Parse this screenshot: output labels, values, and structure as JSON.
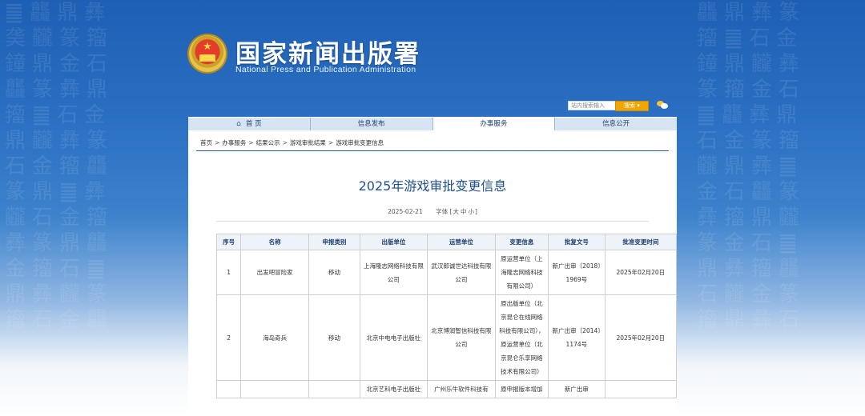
{
  "header": {
    "title_cn": "国家新闻出版署",
    "title_en": "National Press and Publication Administration"
  },
  "search": {
    "placeholder": "站内搜索输入",
    "button_label": "搜索 ▾"
  },
  "nav": {
    "items": [
      "首 页",
      "信息发布",
      "办事服务",
      "信息公开"
    ],
    "active_index": 2
  },
  "breadcrumb": [
    "首页",
    "办事服务",
    "结果公示",
    "游戏审批结果",
    "游戏审批变更信息"
  ],
  "article": {
    "title": "2025年游戏审批变更信息",
    "date": "2025-02-21",
    "font_label": "字体",
    "font_sizes": [
      "大",
      "中",
      "小"
    ]
  },
  "table": {
    "headers": [
      "序号",
      "名称",
      "申报类别",
      "出版单位",
      "运营单位",
      "变更信息",
      "批复文号",
      "批准变更时间"
    ],
    "rows": [
      {
        "no": "1",
        "name": "出发吧冒险家",
        "category": "移动",
        "publisher": "上海隆志网络科技有限公司",
        "operator": "武汉郎诚世达科技有限公司",
        "change": "原运营单位（上海隆志网络科技有限公司）",
        "approval": "新广出审〔2018〕1969号",
        "date": "2025年02月20日"
      },
      {
        "no": "2",
        "name": "海岛奇兵",
        "category": "移动",
        "publisher": "北京中电电子出版社",
        "operator": "北京博润智信科技有限公司",
        "change": "原出版单位（北京昆仑在线网络科技有限公司），原运营单位（北京昆仑乐享网络技术有限公司）",
        "approval": "新广出审〔2014〕1174号",
        "date": "2025年02月20日"
      },
      {
        "no": "",
        "name": "",
        "category": "",
        "publisher": "北京艺科电子出版社",
        "operator": "广州乐牛软件科技有",
        "change": "原申报版本增加",
        "approval": "新广出审",
        "date": ""
      }
    ]
  }
}
